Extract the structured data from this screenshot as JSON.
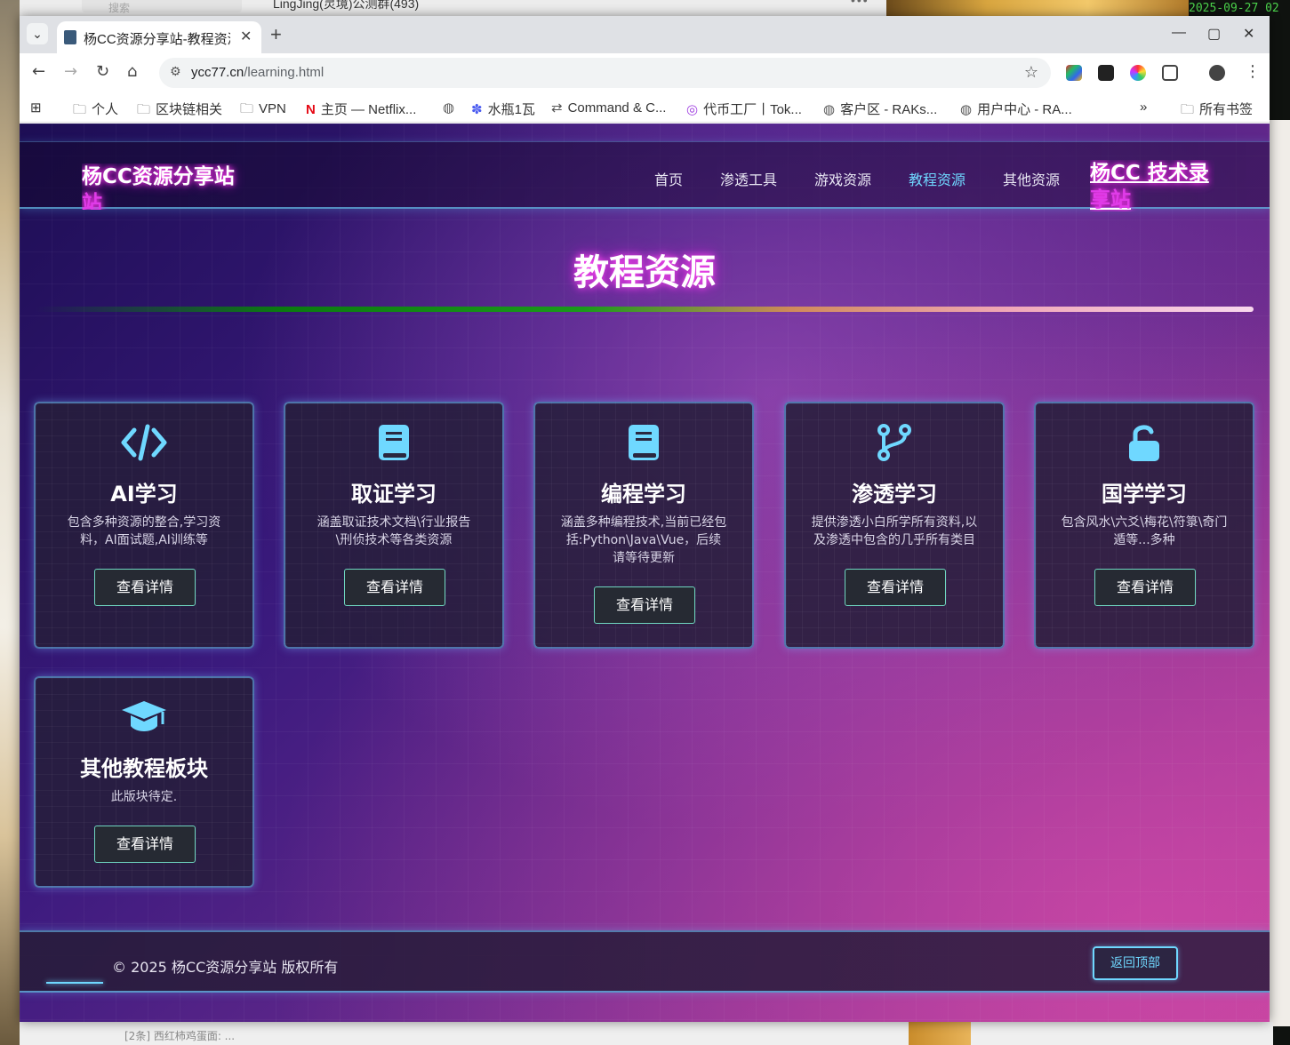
{
  "desktop": {
    "search_placeholder": "搜索",
    "group_title": "LingJing(灵境)公测群(493)",
    "terminal_top": "2025-09-27 02",
    "terminal_prompt": "~>",
    "bottom_item": "[2条] 西红柿鸡蛋面: ..."
  },
  "browser": {
    "tab_title": "杨CC资源分享站-教程资源",
    "url_domain": "ycc77.cn",
    "url_path": "/learning.html",
    "bookmarks": [
      {
        "label": "个人",
        "icon": "folder-icon"
      },
      {
        "label": "区块链相关",
        "icon": "folder-icon"
      },
      {
        "label": "VPN",
        "icon": "folder-icon"
      },
      {
        "label": "主页 — Netflix...",
        "icon": "netflix-icon"
      },
      {
        "label": "",
        "icon": "globe-icon"
      },
      {
        "label": "水瓶1瓦",
        "icon": "paw-icon"
      },
      {
        "label": "Command & C...",
        "icon": "command-icon"
      },
      {
        "label": "代币工厂丨Tok...",
        "icon": "token-icon"
      },
      {
        "label": "客户区 - RAKs...",
        "icon": "globe-icon"
      },
      {
        "label": "用户中心 - RA...",
        "icon": "globe-icon"
      }
    ],
    "overflow": "»",
    "all_bookmarks": "所有书签"
  },
  "site": {
    "logo": "杨CC资源分享站",
    "logo_ghost": "站",
    "nav": [
      "首页",
      "渗透工具",
      "游戏资源",
      "教程资源",
      "其他资源"
    ],
    "nav_active_index": 3,
    "nav_brand": "杨CC 技术录",
    "nav_brand_ghost": "享站",
    "page_title": "教程资源",
    "cards": [
      {
        "icon": "code-icon",
        "title": "AI学习",
        "desc": "包含多种资源的整合,学习资料，AI面试题,AI训练等",
        "button": "查看详情"
      },
      {
        "icon": "book-icon",
        "title": "取证学习",
        "desc": "涵盖取证技术文档\\行业报告\\刑侦技术等各类资源",
        "button": "查看详情"
      },
      {
        "icon": "book-icon",
        "title": "编程学习",
        "desc": "涵盖多种编程技术,当前已经包括:Python\\Java\\Vue，后续请等待更新",
        "button": "查看详情"
      },
      {
        "icon": "code-branch-icon",
        "title": "渗透学习",
        "desc": "提供渗透小白所学所有资料,以及渗透中包含的几乎所有类目",
        "button": "查看详情"
      },
      {
        "icon": "unlock-icon",
        "title": "国学学习",
        "desc": "包含风水\\六爻\\梅花\\符箓\\奇门遁等...多种",
        "button": "查看详情"
      },
      {
        "icon": "graduation-cap-icon",
        "title": "其他教程板块",
        "desc": "此版块待定.",
        "button": "查看详情"
      }
    ],
    "footer_copy": "© 2025 杨CC资源分享站 版权所有",
    "back_to_top": "返回顶部"
  },
  "colors": {
    "accent_cyan": "#6fd8ff",
    "neon_pink": "#ff3cf0",
    "card_border": "#6ebeff"
  }
}
